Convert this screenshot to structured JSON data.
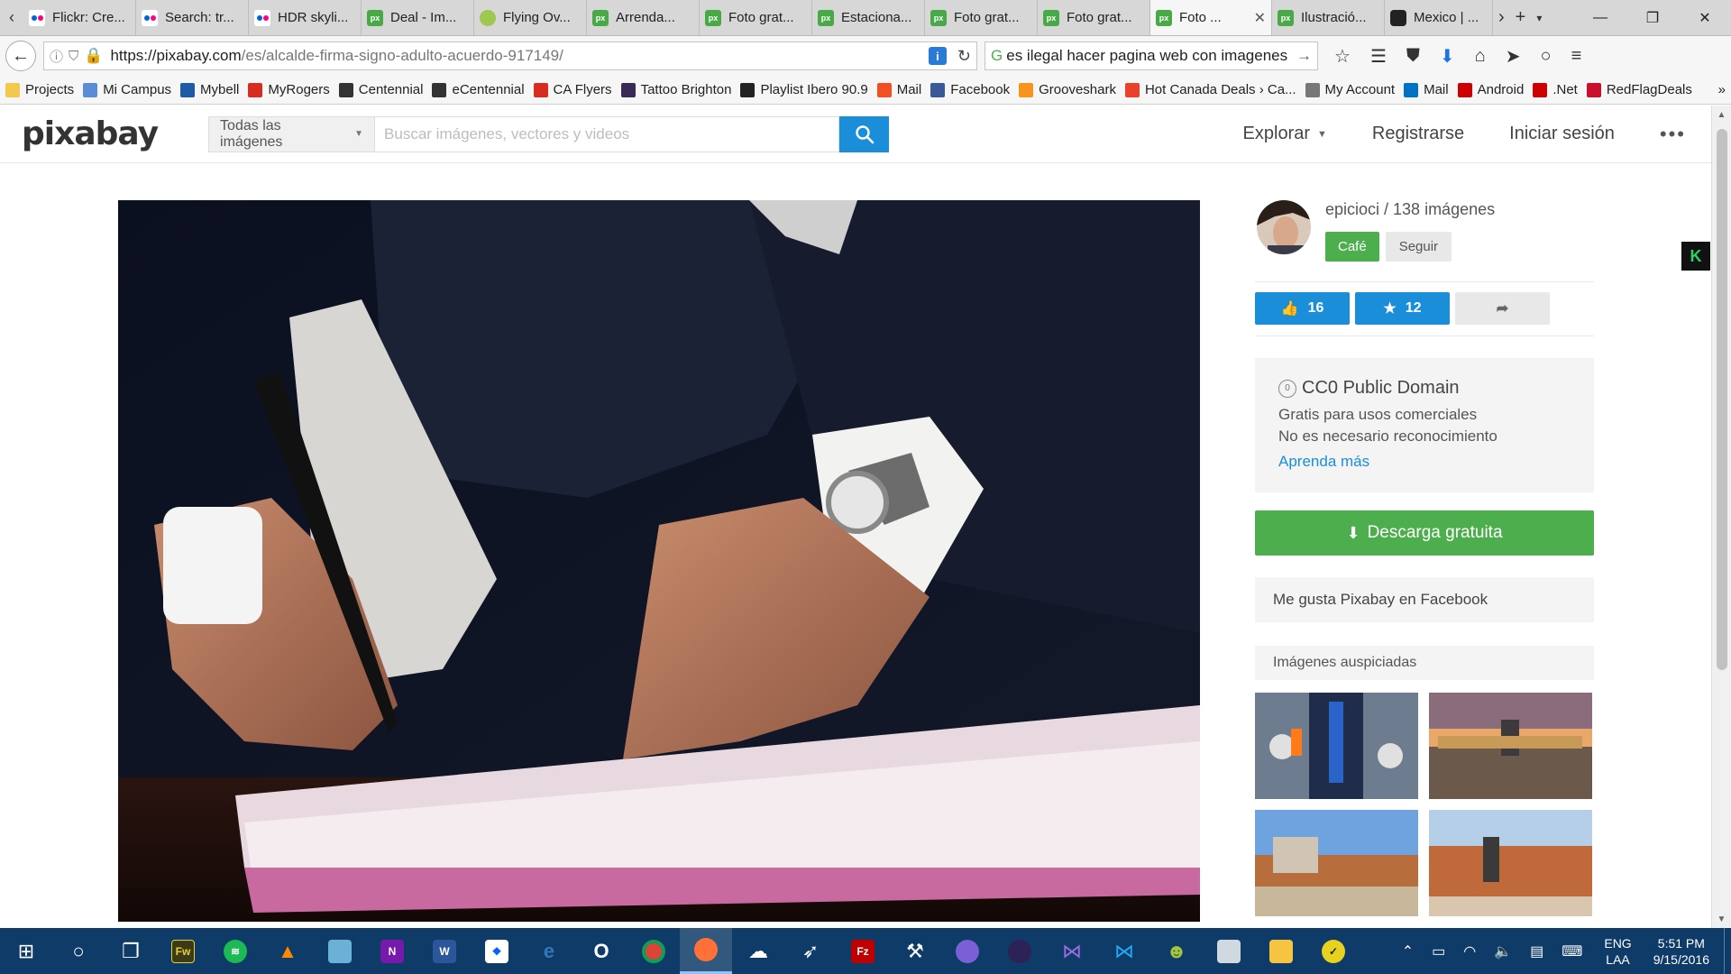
{
  "browser": {
    "tabs": [
      {
        "title": "Flickr: Cre...",
        "icon": "flickr-icon",
        "active": false
      },
      {
        "title": "Search: tr...",
        "icon": "flickr-icon",
        "active": false
      },
      {
        "title": "HDR skyli...",
        "icon": "flickr-icon",
        "active": false
      },
      {
        "title": "Deal - Im...",
        "icon": "pixabay-icon",
        "active": false
      },
      {
        "title": "Flying Ov...",
        "icon": "flying-icon",
        "active": false
      },
      {
        "title": "Arrenda...",
        "icon": "pixabay-icon",
        "active": false
      },
      {
        "title": "Foto grat...",
        "icon": "pixabay-icon",
        "active": false
      },
      {
        "title": "Estaciona...",
        "icon": "pixabay-icon",
        "active": false
      },
      {
        "title": "Foto grat...",
        "icon": "pixabay-icon",
        "active": false
      },
      {
        "title": "Foto grat...",
        "icon": "pixabay-icon",
        "active": false
      },
      {
        "title": "Foto ...",
        "icon": "pixabay-icon",
        "active": true
      },
      {
        "title": "Ilustració...",
        "icon": "pixabay-icon",
        "active": false
      },
      {
        "title": "Mexico | ...",
        "icon": "camera-icon",
        "active": false
      }
    ],
    "url_host": "https://pixabay.com",
    "url_path": "/es/alcalde-firma-signo-adulto-acuerdo-917149/",
    "search_text": "es ilegal hacer pagina web con imagenes",
    "bookmarks": [
      {
        "label": "Projects",
        "color": "#f2c94c"
      },
      {
        "label": "Mi Campus",
        "color": "#5b8dd6"
      },
      {
        "label": "Mybell",
        "color": "#1f5aa6"
      },
      {
        "label": "MyRogers",
        "color": "#d62d20"
      },
      {
        "label": "Centennial",
        "color": "#333333"
      },
      {
        "label": "eCentennial",
        "color": "#333333"
      },
      {
        "label": "CA Flyers",
        "color": "#d62d20"
      },
      {
        "label": "Tattoo Brighton",
        "color": "#3a2a55"
      },
      {
        "label": "Playlist Ibero 90.9",
        "color": "#222222"
      },
      {
        "label": "Mail",
        "color": "#f25022"
      },
      {
        "label": "Facebook",
        "color": "#3b5998"
      },
      {
        "label": "Grooveshark",
        "color": "#f7941d"
      },
      {
        "label": "Hot Canada Deals › Ca...",
        "color": "#e8412c"
      },
      {
        "label": "My Account",
        "color": "#777777"
      },
      {
        "label": "Mail",
        "color": "#0072c6"
      },
      {
        "label": "Android",
        "color": "#cc0000"
      },
      {
        "label": ".Net",
        "color": "#cc0000"
      },
      {
        "label": "RedFlagDeals",
        "color": "#c8102e"
      }
    ]
  },
  "site": {
    "logo": "pixabay",
    "search_category": "Todas las imágenes",
    "search_placeholder": "Buscar imágenes, vectores y videos",
    "nav": {
      "explore": "Explorar",
      "register": "Registrarse",
      "login": "Iniciar sesión"
    }
  },
  "sidebar": {
    "author": "epicioci / 138 imágenes",
    "cafe_label": "Café",
    "follow_label": "Seguir",
    "likes": "16",
    "favorites": "12",
    "license_title": "CC0 Public Domain",
    "license_line1": "Gratis para usos comerciales",
    "license_line2": "No es necesario reconocimiento",
    "license_link": "Aprenda más",
    "download_label": "Descarga gratuita",
    "facebook_label": "Me gusta Pixabay en Facebook",
    "sponsored_label": "Imágenes auspiciadas",
    "badge_letter": "K"
  },
  "taskbar": {
    "lang_line1": "ENG",
    "lang_line2": "LAA",
    "time": "5:51 PM",
    "date": "9/15/2016"
  },
  "colors": {
    "pixabay_green": "#4cae4c",
    "pixabay_blue": "#1a8ed8",
    "taskbar": "#0f3b68"
  }
}
